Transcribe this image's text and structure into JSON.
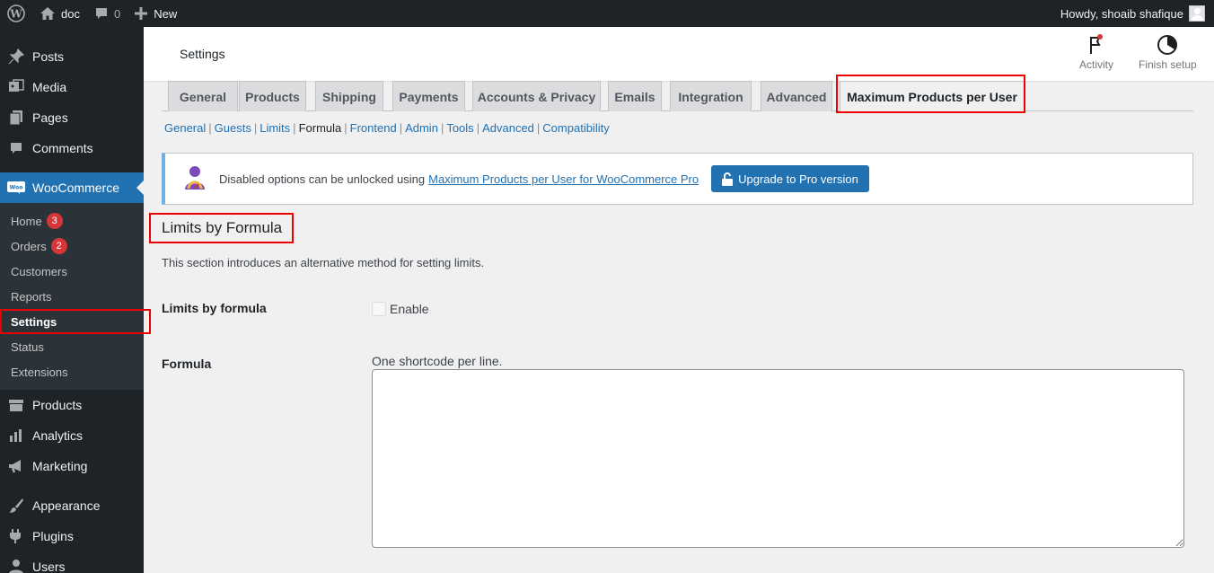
{
  "admin_bar": {
    "site_name": "doc",
    "comments_count": "0",
    "new_label": "New",
    "greeting": "Howdy, shoaib shafique"
  },
  "sidebar": {
    "menu_top": [
      {
        "label": "Posts",
        "icon": "pin-icon"
      },
      {
        "label": "Media",
        "icon": "media-icon"
      },
      {
        "label": "Pages",
        "icon": "pages-icon"
      },
      {
        "label": "Comments",
        "icon": "comment-icon"
      }
    ],
    "woocommerce": "WooCommerce",
    "submenu": [
      {
        "label": "Home",
        "badge": "3"
      },
      {
        "label": "Orders",
        "badge": "2"
      },
      {
        "label": "Customers"
      },
      {
        "label": "Reports"
      },
      {
        "label": "Settings"
      },
      {
        "label": "Status"
      },
      {
        "label": "Extensions"
      }
    ],
    "menu_bottom": [
      {
        "label": "Products",
        "icon": "products-icon"
      },
      {
        "label": "Analytics",
        "icon": "analytics-icon"
      },
      {
        "label": "Marketing",
        "icon": "megaphone-icon"
      },
      {
        "label": "Appearance",
        "icon": "brush-icon"
      },
      {
        "label": "Plugins",
        "icon": "plug-icon"
      },
      {
        "label": "Users",
        "icon": "users-icon"
      }
    ]
  },
  "header": {
    "title": "Settings",
    "activity_label": "Activity",
    "finish_setup_label": "Finish setup"
  },
  "tabs": [
    "General",
    "Products",
    "Shipping",
    "Payments",
    "Accounts & Privacy",
    "Emails",
    "Integration",
    "Advanced",
    "Maximum Products per User"
  ],
  "active_tab": "Maximum Products per User",
  "subnav": [
    "General",
    "Guests",
    "Limits",
    "Formula",
    "Frontend",
    "Admin",
    "Tools",
    "Advanced",
    "Compatibility"
  ],
  "subnav_current": "Formula",
  "notice": {
    "text": "Disabled options can be unlocked using",
    "link": "Maximum Products per User for WooCommerce Pro",
    "button": "Upgrade to Pro version"
  },
  "section": {
    "title": "Limits by Formula",
    "description": "This section introduces an alternative method for setting limits.",
    "fields": {
      "limits_label": "Limits by formula",
      "enable_label": "Enable",
      "enable_checked": false,
      "formula_label": "Formula",
      "formula_desc": "One shortcode per line.",
      "formula_value": ""
    }
  }
}
